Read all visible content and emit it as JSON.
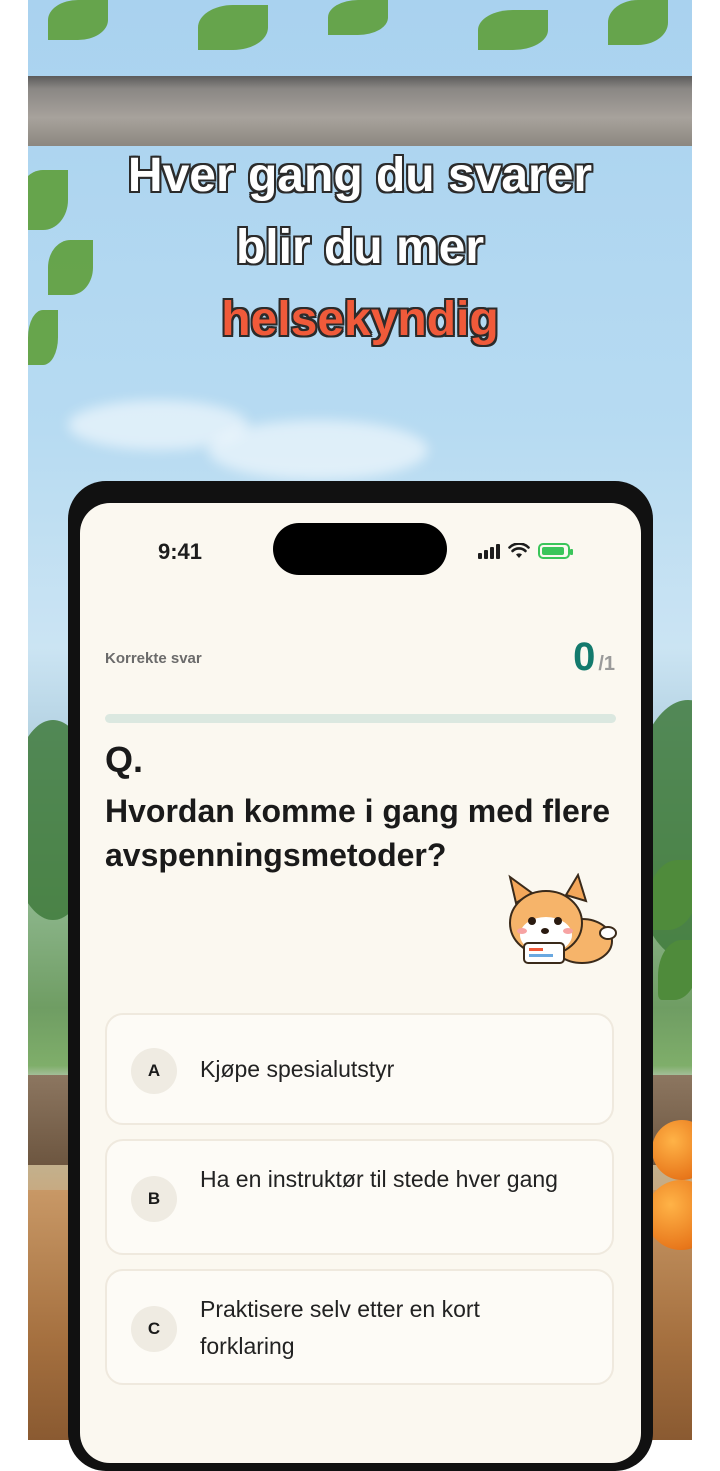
{
  "headline": {
    "line1": "Hver gang du svarer",
    "line2": "blir du mer",
    "line3": "helsekyndig"
  },
  "colors": {
    "accent": "#f05a3a",
    "score": "#137a6d",
    "progress_track": "#dbe8e0"
  },
  "status_bar": {
    "time": "9:41",
    "icons": [
      "signal-icon",
      "wifi-icon",
      "battery-charging-icon"
    ]
  },
  "score": {
    "label": "Korrekte svar",
    "value": "0",
    "total": "/1",
    "progress_fraction": 0
  },
  "question": {
    "label": "Q.",
    "text": "Hvordan komme i gang med flere avspenningsmetoder?"
  },
  "mascot": "corgi-mascot",
  "options": [
    {
      "letter": "A",
      "text": "Kjøpe spesialutstyr"
    },
    {
      "letter": "B",
      "text": "Ha en instruktør til stede hver gang"
    },
    {
      "letter": "C",
      "text": "Praktisere selv etter en kort forklaring"
    }
  ]
}
